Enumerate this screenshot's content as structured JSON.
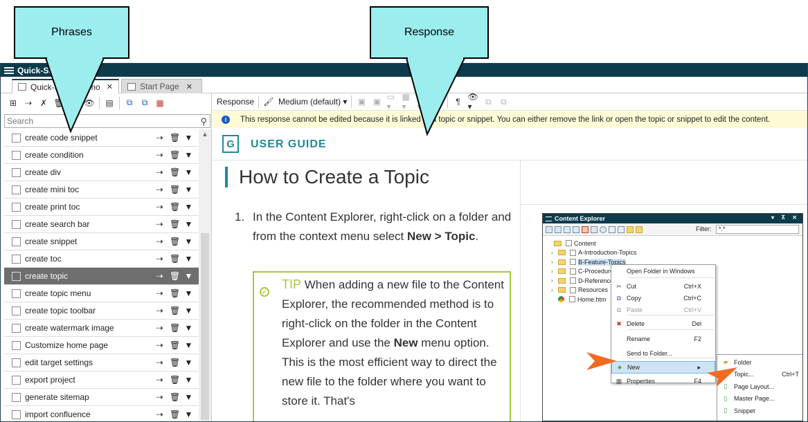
{
  "callouts": {
    "phrases": "Phrases",
    "response": "Response"
  },
  "window": {
    "title": "Quick-Steps Demo"
  },
  "tabs": [
    {
      "label": "Quick-Steps Demo",
      "close": "✕"
    },
    {
      "label": "Start Page",
      "close": "✕"
    }
  ],
  "left": {
    "search_placeholder": "Search",
    "phrases": [
      {
        "label": "create code snippet"
      },
      {
        "label": "create condition"
      },
      {
        "label": "create div"
      },
      {
        "label": "create mini toc"
      },
      {
        "label": "create print toc"
      },
      {
        "label": "create search bar"
      },
      {
        "label": "create snippet"
      },
      {
        "label": "create toc"
      },
      {
        "label": "create topic"
      },
      {
        "label": "create topic menu"
      },
      {
        "label": "create topic toolbar"
      },
      {
        "label": "create watermark image"
      },
      {
        "label": "Customize home page"
      },
      {
        "label": "edit target settings"
      },
      {
        "label": "export project"
      },
      {
        "label": "generate sitemap"
      },
      {
        "label": "import confluence"
      }
    ],
    "selected_index": 8,
    "row_icons": {
      "insert": "⇢",
      "delete": "🗑",
      "menu": "▼"
    }
  },
  "right": {
    "toolbar": {
      "response_label": "Response",
      "medium_label": "Medium (default)",
      "pilcrow": "¶"
    },
    "info_message": "This response cannot be edited because it is linked to a topic or snippet. You can either remove the link or open the topic or snippet to edit the content.",
    "doc": {
      "logo_letter": "G",
      "guide_title": "USER GUIDE",
      "heading": "How to Create a Topic",
      "step_number": "1.",
      "step_text_1": "In the Content Explorer, right-click on a folder and from the context menu select ",
      "step_bold": "New > Topic",
      "step_text_2": ".",
      "tip_label": "TIP",
      "tip_text_1": " When adding a new file to the Content Explorer, the recommended method is to right-click on the folder in the Content Explorer and use the ",
      "tip_bold": "New",
      "tip_text_2": " menu option. This is the most efficient way to direct the new file to the folder where you want to store it. That's"
    },
    "content_explorer": {
      "title": "Content Explorer",
      "filter_label": "Filter:",
      "filter_value": "*.*",
      "tree": [
        {
          "label": "Content"
        },
        {
          "label": "A-Introduction-Topics"
        },
        {
          "label": "B-Feature-Topics"
        },
        {
          "label": "C-Procedures"
        },
        {
          "label": "D-Reference"
        },
        {
          "label": "Resources"
        },
        {
          "label": "Home.htm"
        }
      ],
      "context_menu": [
        {
          "label": "Open Folder in Windows",
          "shortcut": ""
        },
        {
          "label": "Cut",
          "shortcut": "Ctrl+X"
        },
        {
          "label": "Copy",
          "shortcut": "Ctrl+C"
        },
        {
          "label": "Paste",
          "shortcut": "Ctrl+V"
        },
        {
          "label": "Delete",
          "shortcut": "Del"
        },
        {
          "label": "Rename",
          "shortcut": "F2"
        },
        {
          "label": "Send to Folder...",
          "shortcut": ""
        },
        {
          "label": "New",
          "shortcut": "▸"
        },
        {
          "label": "Properties",
          "shortcut": "F4"
        }
      ],
      "submenu": [
        {
          "label": "Folder",
          "shortcut": ""
        },
        {
          "label": "Topic...",
          "shortcut": "Ctrl+T"
        },
        {
          "label": "Page Layout...",
          "shortcut": ""
        },
        {
          "label": "Master Page...",
          "shortcut": ""
        },
        {
          "label": "Snippet",
          "shortcut": ""
        }
      ]
    }
  },
  "colors": {
    "titlebar": "#0d3b4c",
    "accent_teal": "#1d8a99",
    "tip_green": "#a5c93d",
    "callout": "#9BEDEE",
    "info_bg": "#fffbd6",
    "selected_row": "#6e6e6e",
    "arrow_orange": "#f26a21"
  }
}
